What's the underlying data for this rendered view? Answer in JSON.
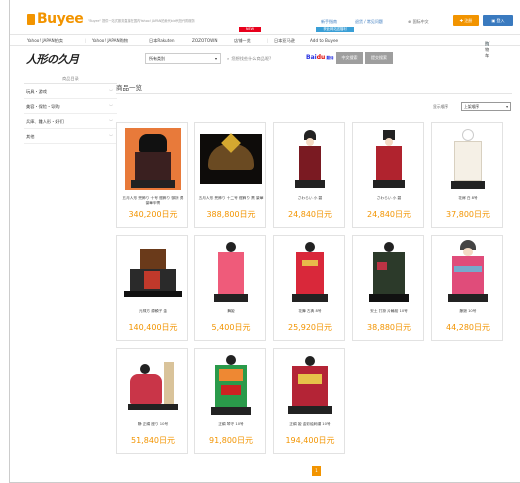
{
  "header": {
    "logo_text": "Buyee",
    "tagline": "\"Buyee\" 提供一站式服务直接在国内Yahoo! JAPAN拍卖代bid代拍代购服务",
    "new_badge": "NEW",
    "blue_badge": "获此网站送福利",
    "links": [
      "新手指南",
      "退货 / 常见问题",
      "国际中文"
    ],
    "register_label": "注册",
    "login_label": "登入"
  },
  "nav": {
    "items": [
      "Yahoo! JAPAN拍卖",
      "Yahoo! JAPAN购物",
      "日本Rakuten",
      "ZOZOTOWN",
      "店铺一览",
      "日本亚马逊",
      "Add to Buyee"
    ],
    "cart_label": "购物车"
  },
  "searchbar": {
    "shop_logo": "人形の久月",
    "category_select": "所有类别",
    "search_placeholder": "您想找些什么商品呢?",
    "baidu_text": "Bai du 翻译",
    "search_cn_label": "中文搜索",
    "search_jp_label": "提交搜索"
  },
  "sidebar": {
    "title": "商品目录",
    "items": [
      "玩具・游戏",
      "美容・保险・导购",
      "兵庫、雛人形・好们",
      "其他"
    ]
  },
  "main": {
    "title": "商品一览",
    "sort_label": "显示顺序",
    "sort_value": "上架顺序"
  },
  "products": [
    {
      "name": "五月人形 兜飾り 十号 鎧飾り 御所 勇 豪華甲冑",
      "price": "340,200日元",
      "kind": "armor"
    },
    {
      "name": "五月人形 兜飾り 十二号 鎧飾り 黒 豪華",
      "price": "388,800日元",
      "kind": "helmet"
    },
    {
      "name": "さわらい 小 碧",
      "price": "24,840日元",
      "kind": "samurai"
    },
    {
      "name": "さわらい 小 碧",
      "price": "24,840日元",
      "kind": "samurai2"
    },
    {
      "name": "花嫁 白 8号",
      "price": "37,800日元",
      "kind": "bride"
    },
    {
      "name": "元禄方 源頼子 金",
      "price": "140,400日元",
      "kind": "shrine"
    },
    {
      "name": "舞姫",
      "price": "5,400日元",
      "kind": "pink"
    },
    {
      "name": "花舞 古典 8号",
      "price": "25,920日元",
      "kind": "redkimono"
    },
    {
      "name": "安土 打掛 片輪桜 10号",
      "price": "38,880日元",
      "kind": "dark"
    },
    {
      "name": "藤娘 10号",
      "price": "44,280日元",
      "kind": "fuji"
    },
    {
      "name": "静 正絹 座り 10号",
      "price": "51,840日元",
      "kind": "seated"
    },
    {
      "name": "正絹 琴守 10号",
      "price": "91,800日元",
      "kind": "colorful"
    },
    {
      "name": "正絹 姫 金彩絵刺繍 10号",
      "price": "194,400日元",
      "kind": "princess"
    }
  ],
  "pager": {
    "current": "1"
  },
  "colors": {
    "accent": "#f29400",
    "new_badge": "#e8001c",
    "blue_badge": "#3a9fd6",
    "login": "#3a7abf"
  }
}
